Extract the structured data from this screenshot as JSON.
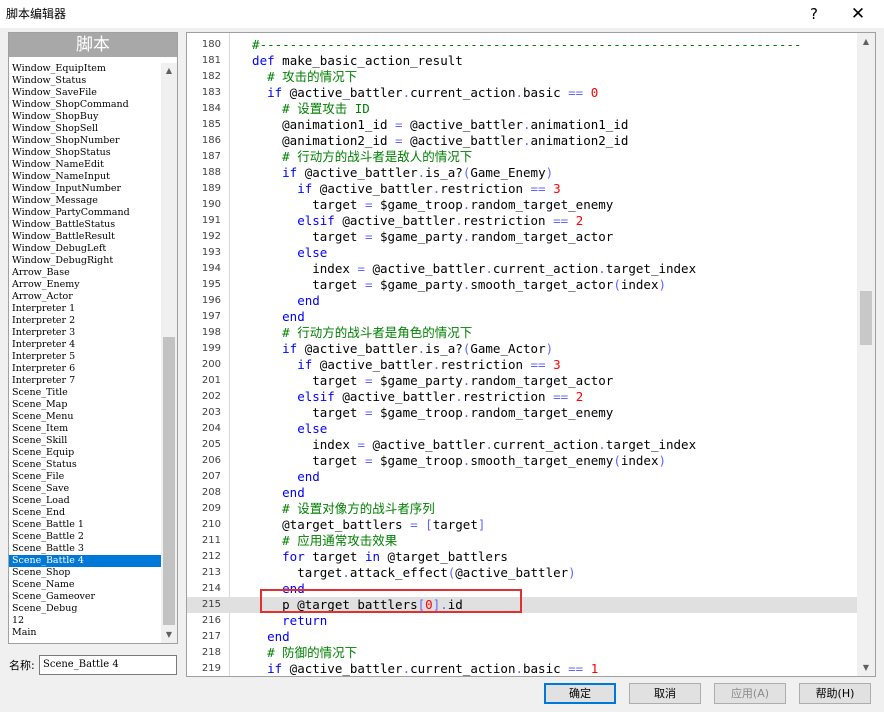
{
  "window": {
    "title": "脚本编辑器",
    "help_glyph": "?",
    "close_glyph": "✕"
  },
  "left": {
    "header": "脚本",
    "scripts": [
      "Window_EquipItem",
      "Window_Status",
      "Window_SaveFile",
      "Window_ShopCommand",
      "Window_ShopBuy",
      "Window_ShopSell",
      "Window_ShopNumber",
      "Window_ShopStatus",
      "Window_NameEdit",
      "Window_NameInput",
      "Window_InputNumber",
      "Window_Message",
      "Window_PartyCommand",
      "Window_BattleStatus",
      "Window_BattleResult",
      "Window_DebugLeft",
      "Window_DebugRight",
      "Arrow_Base",
      "Arrow_Enemy",
      "Arrow_Actor",
      "Interpreter 1",
      "Interpreter 2",
      "Interpreter 3",
      "Interpreter 4",
      "Interpreter 5",
      "Interpreter 6",
      "Interpreter 7",
      "Scene_Title",
      "Scene_Map",
      "Scene_Menu",
      "Scene_Item",
      "Scene_Skill",
      "Scene_Equip",
      "Scene_Status",
      "Scene_File",
      "Scene_Save",
      "Scene_Load",
      "Scene_End",
      "Scene_Battle 1",
      "Scene_Battle 2",
      "Scene_Battle 3",
      "Scene_Battle 4",
      "Scene_Shop",
      "Scene_Name",
      "Scene_Gameover",
      "Scene_Debug",
      "12",
      "Main"
    ],
    "selected": "Scene_Battle 4",
    "name_label": "名称:",
    "name_value": "Scene_Battle 4"
  },
  "editor": {
    "lines": [
      {
        "n": "180",
        "segs": [
          [
            "cm",
            "  #------------------------------------------------------------------------"
          ]
        ]
      },
      {
        "n": "181",
        "segs": [
          [
            "kw",
            "  def"
          ],
          [
            "tx",
            " make_basic_action_result"
          ]
        ]
      },
      {
        "n": "182",
        "segs": [
          [
            "cm",
            "    # 攻击的情况下"
          ]
        ]
      },
      {
        "n": "183",
        "segs": [
          [
            "kw",
            "    if"
          ],
          [
            "tx",
            " @active_battler"
          ],
          [
            "op",
            "."
          ],
          [
            "tx",
            "current_action"
          ],
          [
            "op",
            "."
          ],
          [
            "tx",
            "basic "
          ],
          [
            "op",
            "=="
          ],
          [
            "tx",
            " "
          ],
          [
            "num",
            "0"
          ]
        ]
      },
      {
        "n": "184",
        "segs": [
          [
            "cm",
            "      # 设置攻击 ID"
          ]
        ]
      },
      {
        "n": "185",
        "segs": [
          [
            "tx",
            "      @animation1_id "
          ],
          [
            "op",
            "="
          ],
          [
            "tx",
            " @active_battler"
          ],
          [
            "op",
            "."
          ],
          [
            "tx",
            "animation1_id"
          ]
        ]
      },
      {
        "n": "186",
        "segs": [
          [
            "tx",
            "      @animation2_id "
          ],
          [
            "op",
            "="
          ],
          [
            "tx",
            " @active_battler"
          ],
          [
            "op",
            "."
          ],
          [
            "tx",
            "animation2_id"
          ]
        ]
      },
      {
        "n": "187",
        "segs": [
          [
            "cm",
            "      # 行动方的战斗者是敌人的情况下"
          ]
        ]
      },
      {
        "n": "188",
        "segs": [
          [
            "kw",
            "      if"
          ],
          [
            "tx",
            " @active_battler"
          ],
          [
            "op",
            "."
          ],
          [
            "tx",
            "is_a?"
          ],
          [
            "op",
            "("
          ],
          [
            "tx",
            "Game_Enemy"
          ],
          [
            "op",
            ")"
          ]
        ]
      },
      {
        "n": "189",
        "segs": [
          [
            "kw",
            "        if"
          ],
          [
            "tx",
            " @active_battler"
          ],
          [
            "op",
            "."
          ],
          [
            "tx",
            "restriction "
          ],
          [
            "op",
            "=="
          ],
          [
            "tx",
            " "
          ],
          [
            "num",
            "3"
          ]
        ]
      },
      {
        "n": "190",
        "segs": [
          [
            "tx",
            "          target "
          ],
          [
            "op",
            "="
          ],
          [
            "tx",
            " $game_troop"
          ],
          [
            "op",
            "."
          ],
          [
            "tx",
            "random_target_enemy"
          ]
        ]
      },
      {
        "n": "191",
        "segs": [
          [
            "kw",
            "        elsif"
          ],
          [
            "tx",
            " @active_battler"
          ],
          [
            "op",
            "."
          ],
          [
            "tx",
            "restriction "
          ],
          [
            "op",
            "=="
          ],
          [
            "tx",
            " "
          ],
          [
            "num",
            "2"
          ]
        ]
      },
      {
        "n": "192",
        "segs": [
          [
            "tx",
            "          target "
          ],
          [
            "op",
            "="
          ],
          [
            "tx",
            " $game_party"
          ],
          [
            "op",
            "."
          ],
          [
            "tx",
            "random_target_actor"
          ]
        ]
      },
      {
        "n": "193",
        "segs": [
          [
            "kw",
            "        else"
          ]
        ]
      },
      {
        "n": "194",
        "segs": [
          [
            "tx",
            "          index "
          ],
          [
            "op",
            "="
          ],
          [
            "tx",
            " @active_battler"
          ],
          [
            "op",
            "."
          ],
          [
            "tx",
            "current_action"
          ],
          [
            "op",
            "."
          ],
          [
            "tx",
            "target_index"
          ]
        ]
      },
      {
        "n": "195",
        "segs": [
          [
            "tx",
            "          target "
          ],
          [
            "op",
            "="
          ],
          [
            "tx",
            " $game_party"
          ],
          [
            "op",
            "."
          ],
          [
            "tx",
            "smooth_target_actor"
          ],
          [
            "op",
            "("
          ],
          [
            "tx",
            "index"
          ],
          [
            "op",
            ")"
          ]
        ]
      },
      {
        "n": "196",
        "segs": [
          [
            "kw",
            "        end"
          ]
        ]
      },
      {
        "n": "197",
        "segs": [
          [
            "kw",
            "      end"
          ]
        ]
      },
      {
        "n": "198",
        "segs": [
          [
            "cm",
            "      # 行动方的战斗者是角色的情况下"
          ]
        ]
      },
      {
        "n": "199",
        "segs": [
          [
            "kw",
            "      if"
          ],
          [
            "tx",
            " @active_battler"
          ],
          [
            "op",
            "."
          ],
          [
            "tx",
            "is_a?"
          ],
          [
            "op",
            "("
          ],
          [
            "tx",
            "Game_Actor"
          ],
          [
            "op",
            ")"
          ]
        ]
      },
      {
        "n": "200",
        "segs": [
          [
            "kw",
            "        if"
          ],
          [
            "tx",
            " @active_battler"
          ],
          [
            "op",
            "."
          ],
          [
            "tx",
            "restriction "
          ],
          [
            "op",
            "=="
          ],
          [
            "tx",
            " "
          ],
          [
            "num",
            "3"
          ]
        ]
      },
      {
        "n": "201",
        "segs": [
          [
            "tx",
            "          target "
          ],
          [
            "op",
            "="
          ],
          [
            "tx",
            " $game_party"
          ],
          [
            "op",
            "."
          ],
          [
            "tx",
            "random_target_actor"
          ]
        ]
      },
      {
        "n": "202",
        "segs": [
          [
            "kw",
            "        elsif"
          ],
          [
            "tx",
            " @active_battler"
          ],
          [
            "op",
            "."
          ],
          [
            "tx",
            "restriction "
          ],
          [
            "op",
            "=="
          ],
          [
            "tx",
            " "
          ],
          [
            "num",
            "2"
          ]
        ]
      },
      {
        "n": "203",
        "segs": [
          [
            "tx",
            "          target "
          ],
          [
            "op",
            "="
          ],
          [
            "tx",
            " $game_troop"
          ],
          [
            "op",
            "."
          ],
          [
            "tx",
            "random_target_enemy"
          ]
        ]
      },
      {
        "n": "204",
        "segs": [
          [
            "kw",
            "        else"
          ]
        ]
      },
      {
        "n": "205",
        "segs": [
          [
            "tx",
            "          index "
          ],
          [
            "op",
            "="
          ],
          [
            "tx",
            " @active_battler"
          ],
          [
            "op",
            "."
          ],
          [
            "tx",
            "current_action"
          ],
          [
            "op",
            "."
          ],
          [
            "tx",
            "target_index"
          ]
        ]
      },
      {
        "n": "206",
        "segs": [
          [
            "tx",
            "          target "
          ],
          [
            "op",
            "="
          ],
          [
            "tx",
            " $game_troop"
          ],
          [
            "op",
            "."
          ],
          [
            "tx",
            "smooth_target_enemy"
          ],
          [
            "op",
            "("
          ],
          [
            "tx",
            "index"
          ],
          [
            "op",
            ")"
          ]
        ]
      },
      {
        "n": "207",
        "segs": [
          [
            "kw",
            "        end"
          ]
        ]
      },
      {
        "n": "208",
        "segs": [
          [
            "kw",
            "      end"
          ]
        ]
      },
      {
        "n": "209",
        "segs": [
          [
            "cm",
            "      # 设置对像方的战斗者序列"
          ]
        ]
      },
      {
        "n": "210",
        "segs": [
          [
            "tx",
            "      @target_battlers "
          ],
          [
            "op",
            "="
          ],
          [
            "tx",
            " "
          ],
          [
            "op",
            "["
          ],
          [
            "tx",
            "target"
          ],
          [
            "op",
            "]"
          ]
        ]
      },
      {
        "n": "211",
        "segs": [
          [
            "cm",
            "      # 应用通常攻击效果"
          ]
        ]
      },
      {
        "n": "212",
        "segs": [
          [
            "kw",
            "      for"
          ],
          [
            "tx",
            " target "
          ],
          [
            "kw",
            "in"
          ],
          [
            "tx",
            " @target_battlers"
          ]
        ]
      },
      {
        "n": "213",
        "segs": [
          [
            "tx",
            "        target"
          ],
          [
            "op",
            "."
          ],
          [
            "tx",
            "attack_effect"
          ],
          [
            "op",
            "("
          ],
          [
            "tx",
            "@active_battler"
          ],
          [
            "op",
            ")"
          ]
        ]
      },
      {
        "n": "214",
        "segs": [
          [
            "kw",
            "      end"
          ]
        ]
      },
      {
        "n": "215",
        "segs": [
          [
            "tx",
            "      p @target_battlers"
          ],
          [
            "op",
            "["
          ],
          [
            "num",
            "0"
          ],
          [
            "op",
            "]."
          ],
          [
            "tx",
            "id"
          ]
        ]
      },
      {
        "n": "216",
        "segs": [
          [
            "kw",
            "      return"
          ]
        ]
      },
      {
        "n": "217",
        "segs": [
          [
            "kw",
            "    end"
          ]
        ]
      },
      {
        "n": "218",
        "segs": [
          [
            "cm",
            "    # 防御的情况下"
          ]
        ]
      },
      {
        "n": "219",
        "segs": [
          [
            "kw",
            "    if"
          ],
          [
            "tx",
            " @active_battler"
          ],
          [
            "op",
            "."
          ],
          [
            "tx",
            "current_action"
          ],
          [
            "op",
            "."
          ],
          [
            "tx",
            "basic "
          ],
          [
            "op",
            "=="
          ],
          [
            "tx",
            " "
          ],
          [
            "num",
            "1"
          ]
        ]
      }
    ],
    "highlighted_line": "215"
  },
  "buttons": {
    "ok": "确定",
    "cancel": "取消",
    "apply": "应用(A)",
    "help": "帮助(H)"
  }
}
